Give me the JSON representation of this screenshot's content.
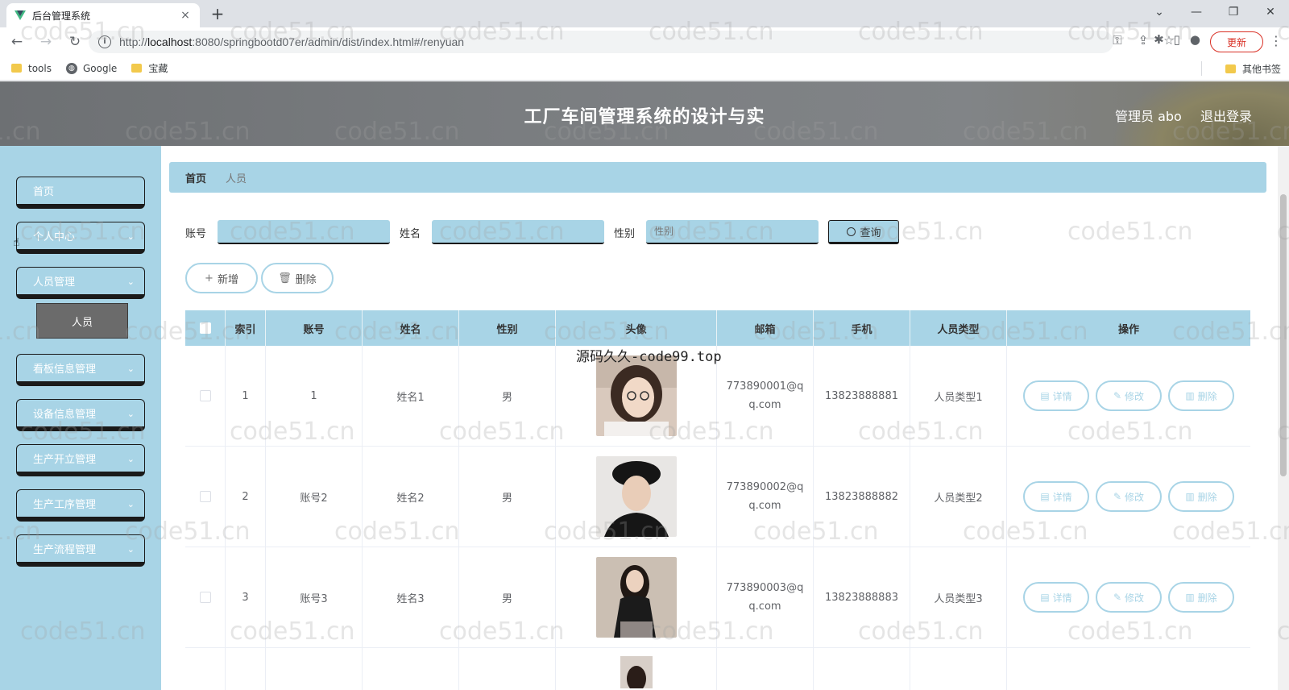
{
  "browser": {
    "tab_title": "后台管理系统",
    "tab_close": "×",
    "new_tab": "+",
    "url_prefix": "http://",
    "url_host": "localhost",
    "url_rest": ":8080/springbootd07er/admin/dist/index.html#/renyuan",
    "update_label": "更新",
    "bookmarks": [
      "tools",
      "Google",
      "宝藏"
    ],
    "other_bookmarks": "其他书签"
  },
  "header": {
    "title": "工厂车间管理系统的设计与实",
    "admin": "管理员 abo",
    "logout": "退出登录"
  },
  "sidebar": {
    "items": [
      {
        "label": "首页",
        "has_chevron": false
      },
      {
        "label": "个人中心",
        "has_chevron": true
      },
      {
        "label": "人员管理",
        "has_chevron": true
      },
      {
        "label": "看板信息管理",
        "has_chevron": true
      },
      {
        "label": "设备信息管理",
        "has_chevron": true
      },
      {
        "label": "生产开立管理",
        "has_chevron": true
      },
      {
        "label": "生产工序管理",
        "has_chevron": true
      },
      {
        "label": "生产流程管理",
        "has_chevron": true
      }
    ],
    "submenu": "人员"
  },
  "breadcrumb": {
    "home": "首页",
    "current": "人员"
  },
  "search": {
    "account_label": "账号",
    "name_label": "姓名",
    "gender_label": "性别",
    "gender_placeholder": "性别",
    "query_label": "查询"
  },
  "actions": {
    "add": "新增",
    "delete": "删除"
  },
  "table": {
    "columns": [
      "索引",
      "账号",
      "姓名",
      "性别",
      "头像",
      "邮箱",
      "手机",
      "人员类型",
      "操作"
    ],
    "rows": [
      {
        "index": "1",
        "account": "1",
        "name": "姓名1",
        "gender": "男",
        "email": "773890001@qq.com",
        "phone": "13823888881",
        "type": "人员类型1"
      },
      {
        "index": "2",
        "account": "账号2",
        "name": "姓名2",
        "gender": "男",
        "email": "773890002@qq.com",
        "phone": "13823888882",
        "type": "人员类型2"
      },
      {
        "index": "3",
        "account": "账号3",
        "name": "姓名3",
        "gender": "男",
        "email": "773890003@qq.com",
        "phone": "13823888883",
        "type": "人员类型3"
      }
    ],
    "op_labels": {
      "detail": "详情",
      "edit": "修改",
      "delete": "删除"
    }
  },
  "overlay_text": "源码久久-code99.top",
  "watermark": "code51.cn",
  "colors": {
    "accent": "#a8d4e6",
    "header": "#7a7d80",
    "submenu": "#6b6b6b"
  }
}
